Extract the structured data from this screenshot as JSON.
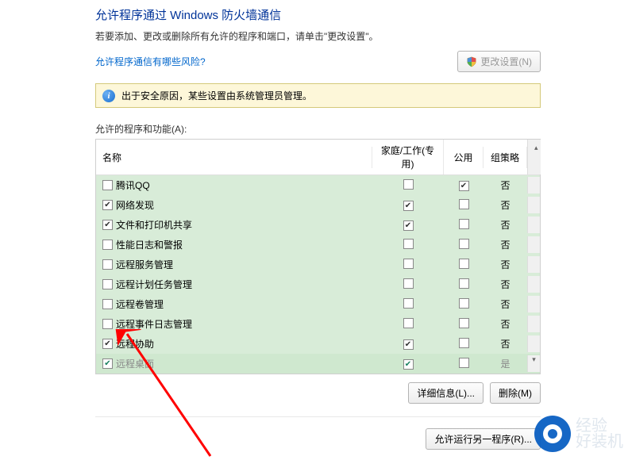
{
  "title": "允许程序通过 Windows 防火墙通信",
  "subtitle": "若要添加、更改或删除所有允许的程序和端口，请单击\"更改设置\"。",
  "risk_link": "允许程序通信有哪些风险?",
  "change_settings_btn": "更改设置(N)",
  "info_text": "出于安全原因，某些设置由系统管理员管理。",
  "list_label": "允许的程序和功能(A):",
  "columns": {
    "name": "名称",
    "home": "家庭/工作(专用)",
    "public": "公用",
    "policy": "组策略"
  },
  "rows": [
    {
      "name": "腾讯QQ",
      "name_checked": false,
      "home": false,
      "public": true,
      "policy": "否",
      "selected": false,
      "disabled": false
    },
    {
      "name": "网络发现",
      "name_checked": true,
      "home": true,
      "public": false,
      "policy": "否",
      "selected": false,
      "disabled": false
    },
    {
      "name": "文件和打印机共享",
      "name_checked": true,
      "home": true,
      "public": false,
      "policy": "否",
      "selected": false,
      "disabled": false
    },
    {
      "name": "性能日志和警报",
      "name_checked": false,
      "home": false,
      "public": false,
      "policy": "否",
      "selected": false,
      "disabled": false
    },
    {
      "name": "远程服务管理",
      "name_checked": false,
      "home": false,
      "public": false,
      "policy": "否",
      "selected": false,
      "disabled": false
    },
    {
      "name": "远程计划任务管理",
      "name_checked": false,
      "home": false,
      "public": false,
      "policy": "否",
      "selected": false,
      "disabled": false
    },
    {
      "name": "远程卷管理",
      "name_checked": false,
      "home": false,
      "public": false,
      "policy": "否",
      "selected": false,
      "disabled": false
    },
    {
      "name": "远程事件日志管理",
      "name_checked": false,
      "home": false,
      "public": false,
      "policy": "否",
      "selected": false,
      "disabled": false
    },
    {
      "name": "远程协助",
      "name_checked": true,
      "home": true,
      "public": false,
      "policy": "否",
      "selected": false,
      "disabled": false
    },
    {
      "name": "远程桌面",
      "name_checked": true,
      "home": true,
      "public": false,
      "policy": "是",
      "selected": true,
      "disabled": true
    }
  ],
  "details_btn": "详细信息(L)...",
  "remove_btn": "删除(M)",
  "allow_another_btn": "允许运行另一程序(R)...",
  "watermark": {
    "line1": "经验",
    "line2": "好装机"
  }
}
